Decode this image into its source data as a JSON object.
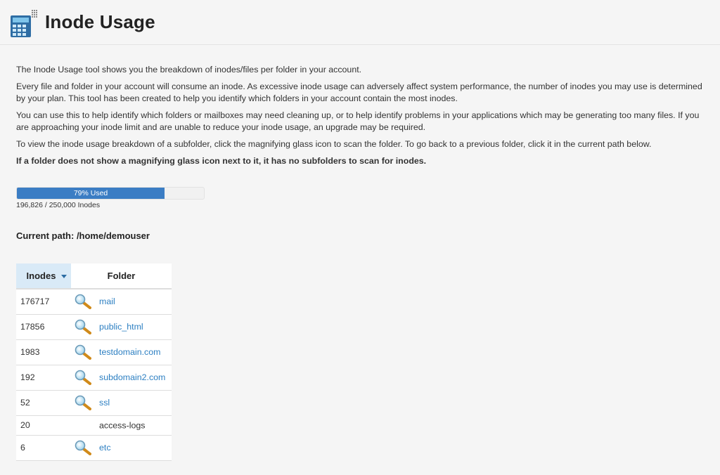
{
  "header": {
    "title": "Inode Usage",
    "icon": "calculator-icon"
  },
  "intro": {
    "p1": "The Inode Usage tool shows you the breakdown of inodes/files per folder in your account.",
    "p2": "Every file and folder in your account will consume an inode. As excessive inode usage can adversely affect system performance, the number of inodes you may use is determined by your plan. This tool has been created to help you identify which folders in your account contain the most inodes.",
    "p3": "You can use this to help identify which folders or mailboxes may need cleaning up, or to help identify problems in your applications which may be generating too many files. If you are approaching your inode limit and are unable to reduce your inode usage, an upgrade may be required.",
    "p4": "To view the inode usage breakdown of a subfolder, click the magnifying glass icon to scan the folder. To go back to a previous folder, click it in the current path below.",
    "p5": "If a folder does not show a magnifying glass icon next to it, it has no subfolders to scan for inodes."
  },
  "usage": {
    "bar_label": "79% Used",
    "fraction": 0.79,
    "count_text": "196,826 / 250,000 Inodes",
    "color": "#3b7dc4"
  },
  "current_path": {
    "label": "Current path: /home/demouser"
  },
  "table": {
    "headers": {
      "inodes": "Inodes",
      "folder": "Folder"
    },
    "rows": [
      {
        "count": "176717",
        "folder": "mail",
        "scannable": true
      },
      {
        "count": "17856",
        "folder": "public_html",
        "scannable": true
      },
      {
        "count": "1983",
        "folder": "testdomain.com",
        "scannable": true
      },
      {
        "count": "192",
        "folder": "subdomain2.com",
        "scannable": true
      },
      {
        "count": "52",
        "folder": "ssl",
        "scannable": true
      },
      {
        "count": "20",
        "folder": "access-logs",
        "scannable": false
      },
      {
        "count": "6",
        "folder": "etc",
        "scannable": true
      }
    ]
  }
}
